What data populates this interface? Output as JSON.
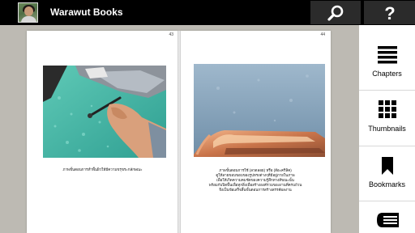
{
  "header": {
    "app_title": "Warawut Books",
    "avatar_icon": "user-avatar",
    "search_icon": "search-icon",
    "help_icon": "help-icon"
  },
  "book": {
    "left_page": {
      "number": "43",
      "caption": "ภาพขั้นตอนการทำพื้นผิวให้มีความขรุขระกลักษณะ"
    },
    "right_page": {
      "number": "44",
      "caption_lines": [
        "ภาพขั้นตอนการใช้ (ลวดลอย) หรือ (สีอะคริลิค)",
        "ดูให้ลายขอบขอบของรูปทรงต่างๆที่มีอยู่ภายในภาพ",
        "เพื่อให้เกิดความคมชัดของความรู้สึกทางสีขณะนั้น",
        "พร้อมกับปิดพื้นเพื่อทุกสิ่งเพื่อสร้างองค์รวมของงานที่ครบถ้วน",
        "จึงเป็นข้อเสร็จสิ้นขั้นตอนการสร้างสรรค์ผลงาน"
      ]
    }
  },
  "sidebar": {
    "items": [
      {
        "label": "Chapters",
        "icon": "list-icon"
      },
      {
        "label": "Thumbnails",
        "icon": "grid-icon"
      },
      {
        "label": "Bookmarks",
        "icon": "bookmark-icon"
      },
      {
        "label": "",
        "icon": "book-icon"
      }
    ]
  },
  "colors": {
    "header_bg": "#000000",
    "header_button_bg": "#2b2b2b",
    "reader_bg": "#bdbab3",
    "sidebar_bg": "#ffffff"
  }
}
